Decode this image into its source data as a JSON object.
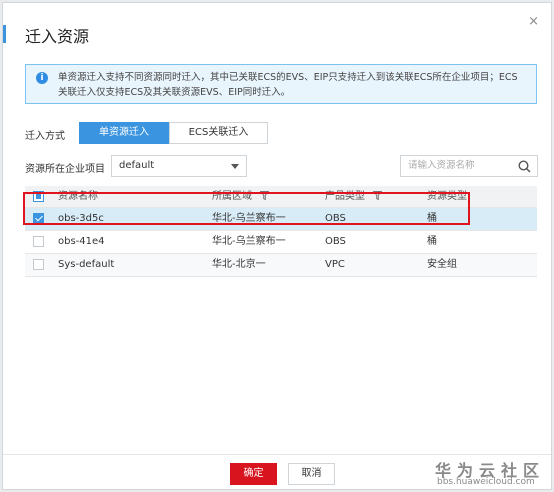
{
  "dialog": {
    "title": "迁入资源",
    "close_glyph": "×"
  },
  "info": {
    "icon_glyph": "i",
    "line1": "单资源迁入支持不同资源同时迁入，其中已关联ECS的EVS、EIP只支持迁入到该关联ECS所在企业项目；ECS",
    "line2": "关联迁入仅支持ECS及其关联资源EVS、EIP同时迁入。"
  },
  "migrate": {
    "label": "迁入方式",
    "tabs": [
      {
        "label": "单资源迁入",
        "active": true
      },
      {
        "label": "ECS关联迁入",
        "active": false
      }
    ]
  },
  "project": {
    "label": "资源所在企业项目",
    "value": "default"
  },
  "search": {
    "placeholder": "请输入资源名称"
  },
  "table": {
    "columns": [
      "资源名称",
      "所属区域",
      "产品类型",
      "资源类型"
    ],
    "rows": [
      {
        "name": "obs-3d5c",
        "region": "华北-乌兰察布一",
        "product": "OBS",
        "type": "桶",
        "checked": true
      },
      {
        "name": "obs-41e4",
        "region": "华北-乌兰察布一",
        "product": "OBS",
        "type": "桶",
        "checked": false
      },
      {
        "name": "Sys-default",
        "region": "华北-北京一",
        "product": "VPC",
        "type": "安全组",
        "checked": false
      }
    ]
  },
  "footer": {
    "ok_label": "确定",
    "cancel_label": "取消"
  },
  "watermark": {
    "line1": "华为云社区",
    "line2": "bbs.huaweicloud.com"
  },
  "colors": {
    "accent": "#3a94e0",
    "confirm": "#d8151f",
    "highlight_box": "#e0141e",
    "info_bg": "#e9f5fd"
  }
}
